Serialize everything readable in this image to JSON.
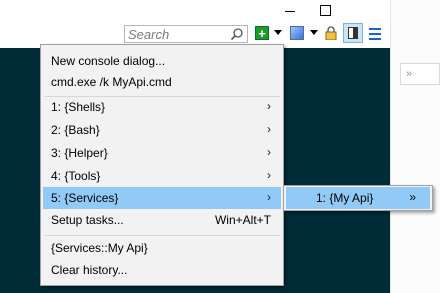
{
  "toolbar": {
    "search_placeholder": "Search"
  },
  "menu": {
    "items": [
      {
        "label": "New console dialog..."
      },
      {
        "label": "cmd.exe /k MyApi.cmd"
      },
      {
        "label": "1: {Shells}",
        "arrow": "›"
      },
      {
        "label": "2: {Bash}",
        "arrow": "›"
      },
      {
        "label": "3: {Helper}",
        "arrow": "›"
      },
      {
        "label": "4: {Tools}",
        "arrow": "›"
      },
      {
        "label": "5: {Services}",
        "arrow": "›"
      },
      {
        "label": "Setup tasks...",
        "shortcut": "Win+Alt+T"
      },
      {
        "label": "{Services::My Api}"
      },
      {
        "label": "Clear history..."
      }
    ]
  },
  "submenu": {
    "items": [
      {
        "label": "1: {My Api}",
        "arrow": "»"
      }
    ]
  },
  "colors": {
    "console_bg": "#012b36",
    "highlight": "#91c9f7",
    "menu_bg": "#f2f2f2",
    "new_console_icon": "#1c9a2b"
  }
}
